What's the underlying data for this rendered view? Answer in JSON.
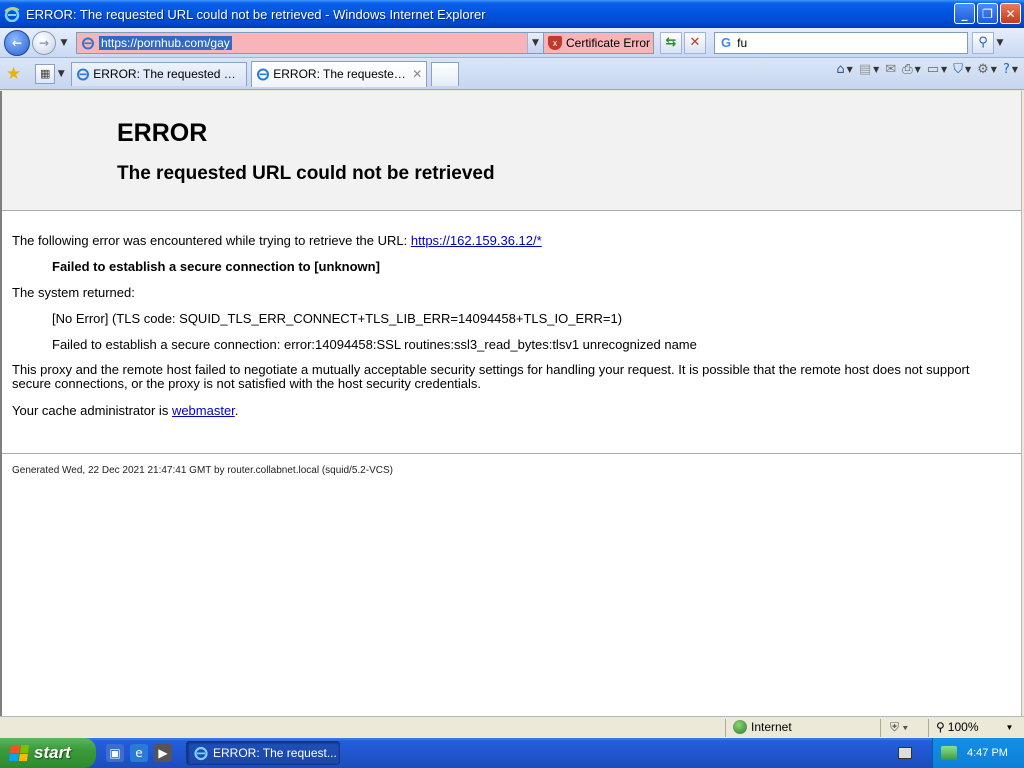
{
  "window": {
    "title": "ERROR: The requested URL could not be retrieved - Windows Internet Explorer",
    "minimize": "_",
    "maximize": "❐",
    "close": "✕"
  },
  "nav": {
    "back": "←",
    "forward": "→",
    "dropdown": "▼",
    "address_url": "https://pornhub.com/gay",
    "certificate_error": "Certificate Error",
    "refresh": "⇆",
    "stop": "✕",
    "search_engine_glyph": "G",
    "search_value": "fu",
    "search_glyph": "⚲"
  },
  "tabs": {
    "quick_tabs_glyph": "▦",
    "items": [
      {
        "label": "ERROR: The requested URL ...",
        "active": false
      },
      {
        "label": "ERROR: The requested U...",
        "active": true,
        "close": "✕"
      }
    ]
  },
  "page": {
    "heading": "ERROR",
    "subheading": "The requested URL could not be retrieved",
    "intro": "The following error was encountered while trying to retrieve the URL: ",
    "link_url": "https://162.159.36.12/*",
    "failed_msg": "Failed to establish a secure connection to [unknown]",
    "system_returned": "The system returned:",
    "tls_code": "[No Error] (TLS code: SQUID_TLS_ERR_CONNECT+TLS_LIB_ERR=14094458+TLS_IO_ERR=1)",
    "ssl_error": "Failed to establish a secure connection: error:14094458:SSL routines:ssl3_read_bytes:tlsv1 unrecognized name",
    "explanation": "This proxy and the remote host failed to negotiate a mutually acceptable security settings for handling your request. It is possible that the remote host does not support secure connections, or the proxy is not satisfied with the host security credentials.",
    "admin_prefix": "Your cache administrator is ",
    "admin_link": "webmaster",
    "admin_suffix": ".",
    "footer": "Generated Wed, 22 Dec 2021 21:47:41 GMT by router.collabnet.local (squid/5.2-VCS)"
  },
  "statusbar": {
    "zone": "Internet",
    "zoom": "100%"
  },
  "taskbar": {
    "start": "start",
    "task_label": "ERROR: The request...",
    "clock": "4:47 PM"
  },
  "icons": {
    "favorites": "favorites-star-icon",
    "home": "home-icon",
    "feeds": "rss-feeds-icon",
    "mail": "read-mail-icon",
    "print": "print-icon",
    "page": "page-menu-icon",
    "safety": "safety-icon",
    "tools": "tools-gear-icon",
    "help": "help-icon"
  },
  "colors": {
    "address_error_bg": "#f7b5b9",
    "link": "#0000cc",
    "titlebar": "#0053e1"
  }
}
